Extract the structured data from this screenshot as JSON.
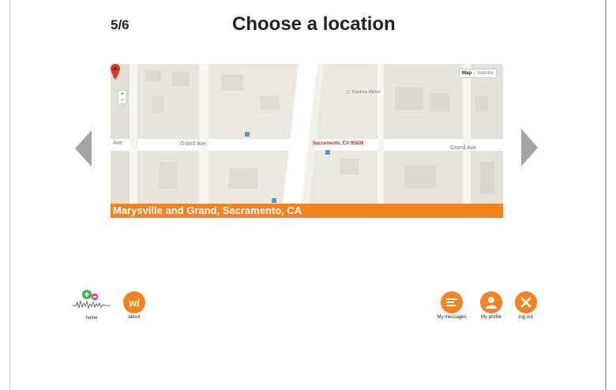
{
  "header": {
    "step": "5/6",
    "title": "Choose a location"
  },
  "map": {
    "map_button": "Map",
    "satellite_button": "Satellite",
    "zoom_in": "+",
    "zoom_out": "−",
    "streets": [
      "Ave",
      "Grand Ave",
      "Grand Ave"
    ],
    "poi_label": "Rainbow Market",
    "pin_label": "Sacramento, CA 95838"
  },
  "caption": "Marysville and Grand, Sacramento, CA",
  "nav": {
    "home_label": "home",
    "about_label": "about",
    "about_logo": "w/",
    "messages_label": "My messages",
    "profile_label": "My profile",
    "logout_label": "log out"
  },
  "colors": {
    "accent": "#f58220",
    "arrow": "#a4a4a4",
    "map_bg": "#ebe7df",
    "pin": "#d6382e"
  }
}
